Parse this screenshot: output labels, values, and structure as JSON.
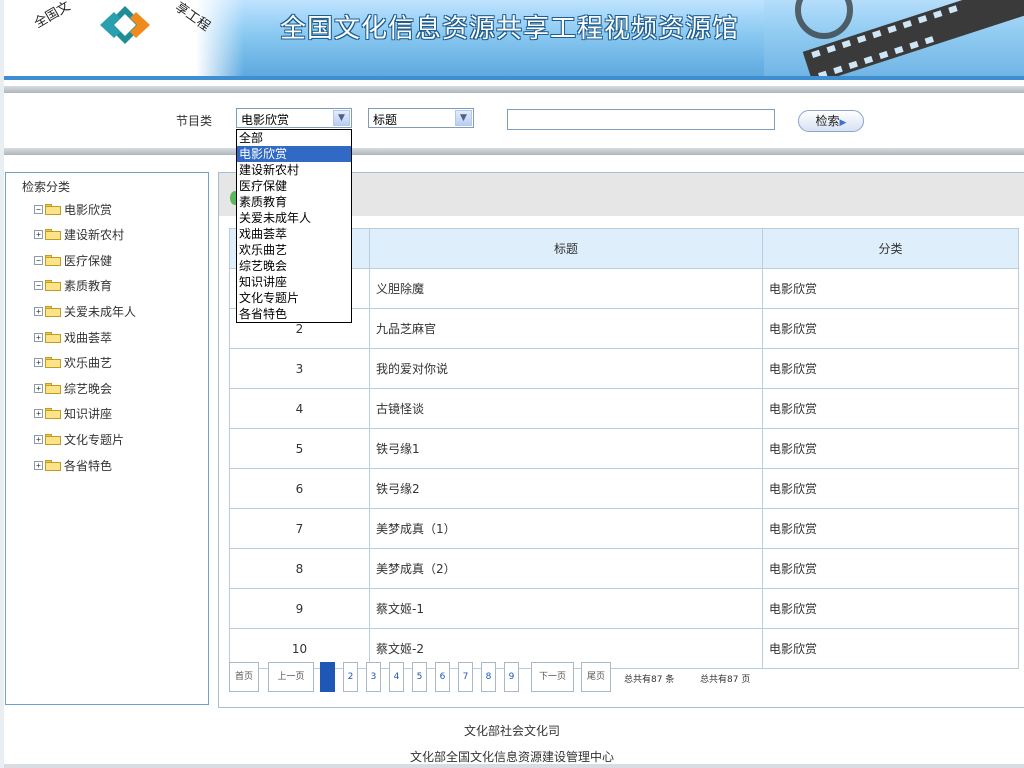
{
  "banner": {
    "title": "全国文化信息资源共享工程视频资源馆",
    "org_left": "全国文",
    "org_right": "享工程"
  },
  "search": {
    "label": "节目类",
    "category_value": "电影欣赏",
    "field_value": "标题",
    "keyword_value": "",
    "search_button": "检索"
  },
  "dropdown": {
    "options": [
      "全部",
      "电影欣赏",
      "建设新农村",
      "医疗保健",
      "素质教育",
      "关爱未成年人",
      "戏曲荟萃",
      "欢乐曲艺",
      "综艺晚会",
      "知识讲座",
      "文化专题片",
      "各省特色"
    ],
    "selected_index": 1
  },
  "tree": {
    "title": "检索分类",
    "items": [
      {
        "label": "电影欣赏",
        "toggle": "−"
      },
      {
        "label": "建设新农村",
        "toggle": "+"
      },
      {
        "label": "医疗保健",
        "toggle": "−"
      },
      {
        "label": "素质教育",
        "toggle": "−"
      },
      {
        "label": "关爱未成年人",
        "toggle": "+"
      },
      {
        "label": "戏曲荟萃",
        "toggle": "+"
      },
      {
        "label": "欢乐曲艺",
        "toggle": "+"
      },
      {
        "label": "综艺晚会",
        "toggle": "+"
      },
      {
        "label": "知识讲座",
        "toggle": "+"
      },
      {
        "label": "文化专题片",
        "toggle": "+"
      },
      {
        "label": "各省特色",
        "toggle": "+"
      }
    ]
  },
  "table": {
    "columns": [
      "",
      "标题",
      "分类"
    ],
    "rows": [
      {
        "num": "1",
        "title": "义胆除魔",
        "category": "电影欣赏"
      },
      {
        "num": "2",
        "title": "九品芝麻官",
        "category": "电影欣赏"
      },
      {
        "num": "3",
        "title": "我的爱对你说",
        "category": "电影欣赏"
      },
      {
        "num": "4",
        "title": "古镜怪谈",
        "category": "电影欣赏"
      },
      {
        "num": "5",
        "title": "铁弓缘1",
        "category": "电影欣赏"
      },
      {
        "num": "6",
        "title": "铁弓缘2",
        "category": "电影欣赏"
      },
      {
        "num": "7",
        "title": "美梦成真（1）",
        "category": "电影欣赏"
      },
      {
        "num": "8",
        "title": "美梦成真（2）",
        "category": "电影欣赏"
      },
      {
        "num": "9",
        "title": "蔡文姬-1",
        "category": "电影欣赏"
      },
      {
        "num": "10",
        "title": "蔡文姬-2",
        "category": "电影欣赏"
      }
    ]
  },
  "pager": {
    "first": "首页",
    "prev": "上一页",
    "pages": [
      "1",
      "2",
      "3",
      "4",
      "5",
      "6",
      "7",
      "8",
      "9"
    ],
    "current": "1",
    "next": "下一页",
    "last": "尾页",
    "total_items": "总共有87 条",
    "total_pages": "总共有87 页"
  },
  "footer": {
    "line1": "文化部社会文化司",
    "line2": "文化部全国文化信息资源建设管理中心"
  },
  "colors": {
    "banner_blue": "#5fa9df",
    "accent": "#1f57b6",
    "header_row": "#deeefa",
    "selection": "#316ac5"
  }
}
